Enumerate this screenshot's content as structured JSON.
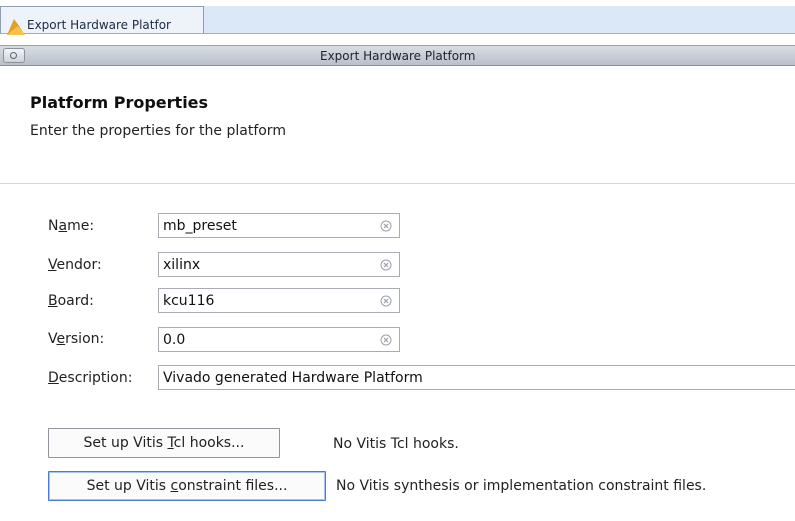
{
  "taskbar": {
    "task_label": "Export Hardware Platfor"
  },
  "window": {
    "title": "Export Hardware Platform"
  },
  "header": {
    "title": "Platform Properties",
    "subtitle": "Enter the properties for the platform"
  },
  "form": {
    "name": {
      "label_pre": "N",
      "label_u": "a",
      "label_post": "me:",
      "value": "mb_preset"
    },
    "vendor": {
      "label_pre": "",
      "label_u": "V",
      "label_post": "endor:",
      "value": "xilinx"
    },
    "board": {
      "label_pre": "",
      "label_u": "B",
      "label_post": "oard:",
      "value": "kcu116"
    },
    "version": {
      "label_pre": "V",
      "label_u": "e",
      "label_post": "rsion:",
      "value": "0.0"
    },
    "description": {
      "label_pre": "",
      "label_u": "D",
      "label_post": "escription:",
      "value": "Vivado generated Hardware Platform"
    }
  },
  "hooks": {
    "tcl_button": {
      "pre": "Set up Vitis ",
      "u": "T",
      "post": "cl hooks..."
    },
    "tcl_status": "No Vitis Tcl hooks.",
    "constraint_button": {
      "pre": "Set up Vitis ",
      "u": "c",
      "post": "onstraint files..."
    },
    "constraint_status": "No Vitis synthesis or implementation constraint files."
  },
  "colors": {
    "taskbar_band": "#dbe8f8",
    "focus_border": "#4a7bd0"
  }
}
